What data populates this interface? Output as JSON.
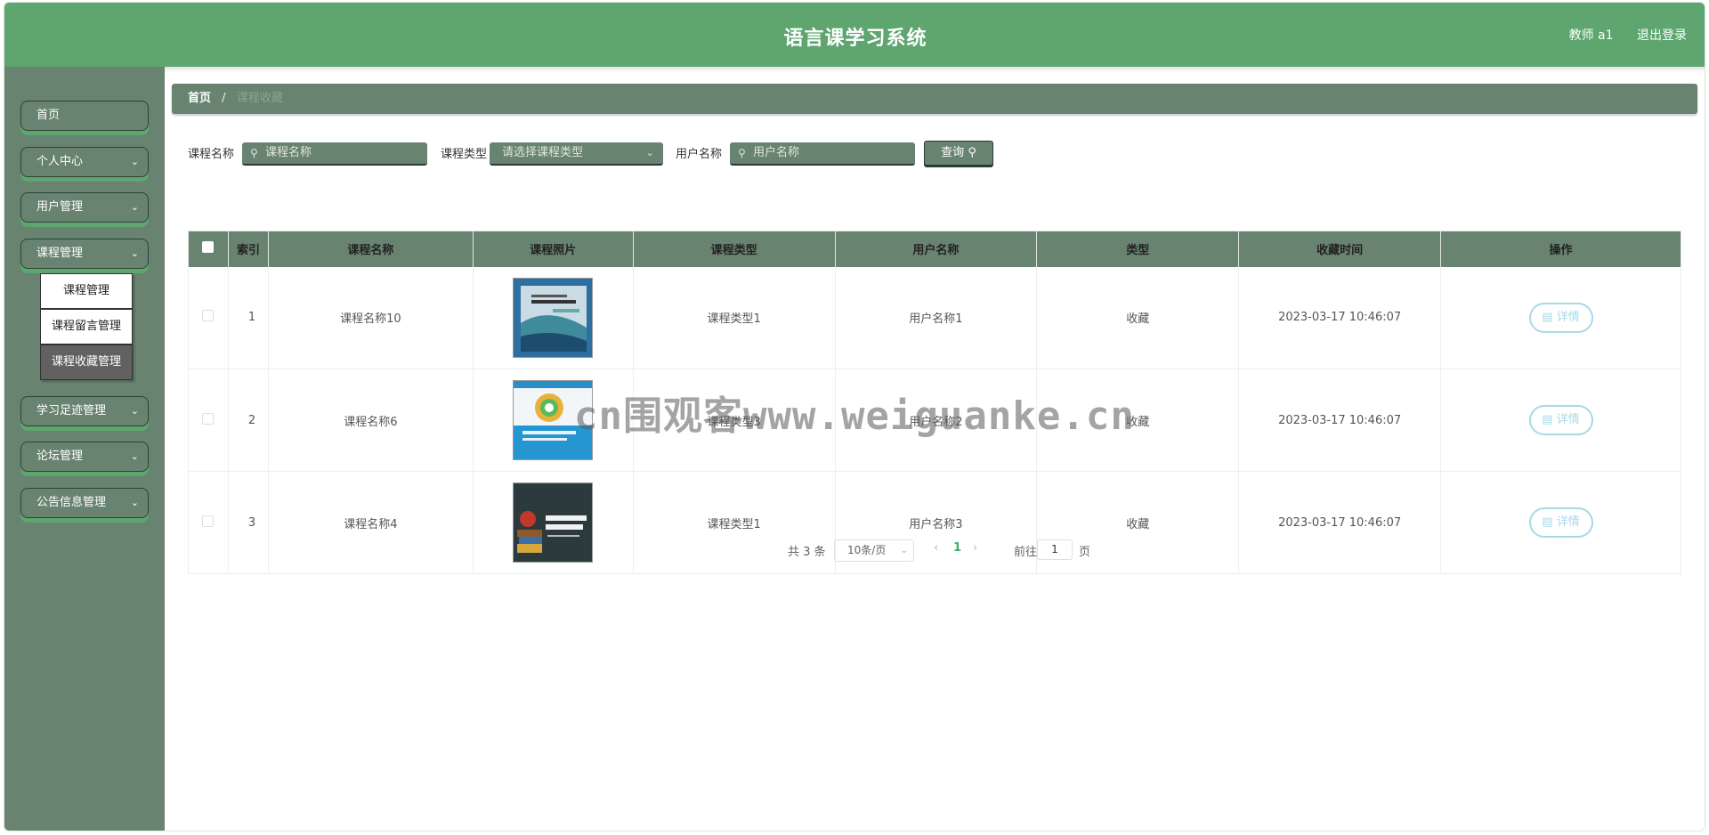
{
  "header": {
    "title": "语言课学习系统",
    "user": "教师 a1",
    "logout": "退出登录"
  },
  "sidebar": {
    "items": [
      {
        "label": "首页",
        "has_chevron": false
      },
      {
        "label": "个人中心",
        "has_chevron": true
      },
      {
        "label": "用户管理",
        "has_chevron": true
      },
      {
        "label": "课程管理",
        "has_chevron": true
      },
      {
        "label": "学习足迹管理",
        "has_chevron": true
      },
      {
        "label": "论坛管理",
        "has_chevron": true
      },
      {
        "label": "公告信息管理",
        "has_chevron": true
      }
    ],
    "sub_items": [
      {
        "label": "课程管理",
        "active": false
      },
      {
        "label": "课程留言管理",
        "active": false
      },
      {
        "label": "课程收藏管理",
        "active": true
      }
    ]
  },
  "breadcrumb": {
    "home": "首页",
    "separator": "/",
    "current": "课程收藏"
  },
  "search": {
    "course_name_label": "课程名称",
    "course_name_placeholder": "课程名称",
    "course_type_label": "课程类型",
    "course_type_placeholder": "请选择课程类型",
    "user_name_label": "用户名称",
    "user_name_placeholder": "用户名称",
    "query_button": "查询"
  },
  "table": {
    "headers": [
      "索引",
      "课程名称",
      "课程照片",
      "课程类型",
      "用户名称",
      "类型",
      "收藏时间",
      "操作"
    ],
    "rows": [
      {
        "index": "1",
        "course_name": "课程名称10",
        "course_type": "课程类型1",
        "user_name": "用户名称1",
        "type": "收藏",
        "time": "2023-03-17 10:46:07",
        "action": "详情"
      },
      {
        "index": "2",
        "course_name": "课程名称6",
        "course_type": "课程类型3",
        "user_name": "用户名称2",
        "type": "收藏",
        "time": "2023-03-17 10:46:07",
        "action": "详情"
      },
      {
        "index": "3",
        "course_name": "课程名称4",
        "course_type": "课程类型1",
        "user_name": "用户名称3",
        "type": "收藏",
        "time": "2023-03-17 10:46:07",
        "action": "详情"
      }
    ]
  },
  "pagination": {
    "total": "共 3 条",
    "page_size": "10条/页",
    "current_page": "1",
    "goto_label": "前往",
    "goto_value": "1",
    "page_label": "页"
  },
  "watermark": "cn围观客www.weiguanke.cn",
  "colors": {
    "header": "#5ea56f",
    "sidebar": "#68836f",
    "accent": "#3eb06b",
    "detail_button": "#a9d8e8"
  }
}
